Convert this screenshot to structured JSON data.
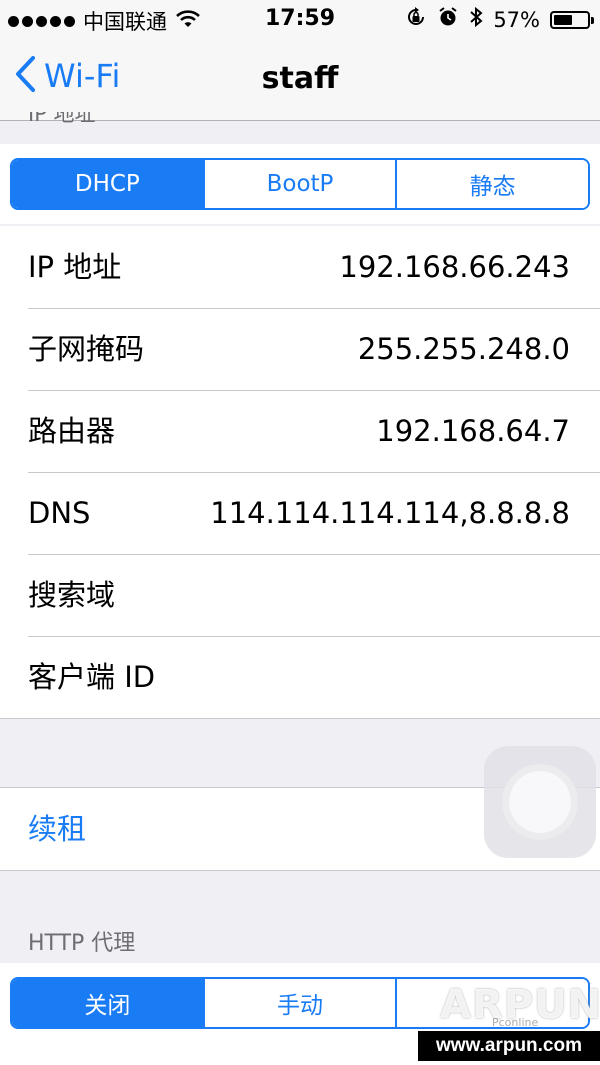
{
  "status_bar": {
    "carrier": "中国联通",
    "time": "17:59",
    "battery_percent": "57%",
    "battery_level": 0.57,
    "signal_bars": 5
  },
  "nav": {
    "back_label": "Wi-Fi",
    "title": "staff"
  },
  "ip_section": {
    "header": "IP 地址",
    "modes": [
      "DHCP",
      "BootP",
      "静态"
    ],
    "selected_mode": "DHCP",
    "rows": [
      {
        "label": "IP 地址",
        "value": "192.168.66.243"
      },
      {
        "label": "子网掩码",
        "value": "255.255.248.0"
      },
      {
        "label": "路由器",
        "value": "192.168.64.7"
      },
      {
        "label": "DNS",
        "value": "114.114.114.114,8.8.8.8"
      },
      {
        "label": "搜索域",
        "value": ""
      },
      {
        "label": "客户端 ID",
        "value": ""
      }
    ]
  },
  "renew_label": "续租",
  "proxy_section": {
    "header": "HTTP 代理",
    "modes": [
      "关闭",
      "手动",
      ""
    ],
    "selected_mode": "关闭"
  },
  "watermark": {
    "logo": "ARPUN",
    "sub": "Pconline",
    "url": "www.arpun.com"
  },
  "colors": {
    "accent": "#1a7cf5",
    "background": "#efeff4",
    "separator": "#c8c7cc",
    "header_text": "#6d6d72"
  },
  "icons": [
    "signal-dots-icon",
    "wifi-icon",
    "chevron-left-icon",
    "rotation-lock-icon",
    "alarm-icon",
    "bluetooth-icon",
    "battery-icon"
  ]
}
